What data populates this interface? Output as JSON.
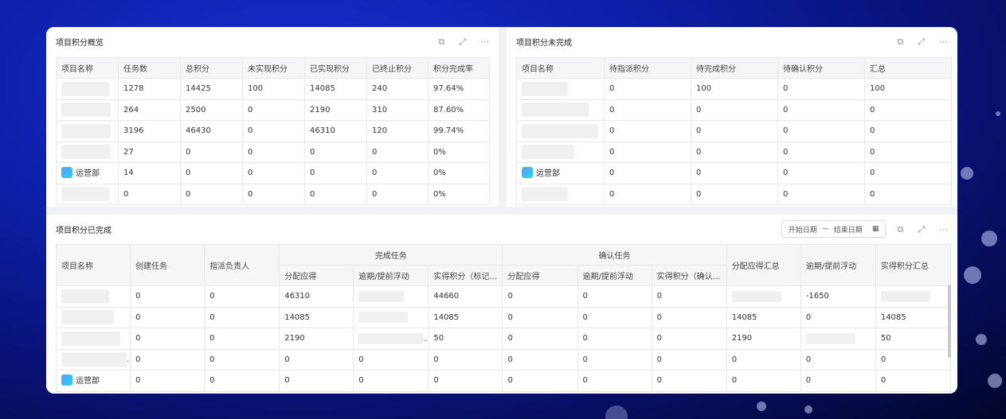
{
  "icons": {
    "export": "export-icon",
    "expand": "expand-icon",
    "more": "more-icon",
    "calendar": "calendar-icon",
    "dept": "dept-icon"
  },
  "overview": {
    "title": "项目积分概览",
    "headers": [
      "项目名称",
      "任务数",
      "总积分",
      "未实现积分",
      "已实现积分",
      "已终止积分",
      "积分完成率"
    ],
    "rows": [
      [
        "",
        "1278",
        "14425",
        "100",
        "14085",
        "240",
        "97.64%"
      ],
      [
        "",
        "264",
        "2500",
        "0",
        "2190",
        "310",
        "87.60%"
      ],
      [
        "",
        "3196",
        "46430",
        "0",
        "46310",
        "120",
        "99.74%"
      ],
      [
        "",
        "27",
        "0",
        "0",
        "0",
        "0",
        "0%"
      ],
      [
        "运营部",
        "14",
        "0",
        "0",
        "0",
        "0",
        "0%"
      ],
      [
        "",
        "0",
        "0",
        "0",
        "0",
        "0",
        "0%"
      ]
    ]
  },
  "incomplete": {
    "title": "项目积分未完成",
    "headers": [
      "项目名称",
      "待指派积分",
      "待完成积分",
      "待确认积分",
      "汇总"
    ],
    "rows": [
      [
        "",
        "0",
        "100",
        "0",
        "100"
      ],
      [
        "",
        "0",
        "0",
        "0",
        "0"
      ],
      [
        "",
        "0",
        "0",
        "0",
        "0"
      ],
      [
        "",
        "0",
        "0",
        "0",
        "0"
      ],
      [
        "运营部",
        "0",
        "0",
        "0",
        "0"
      ],
      [
        "",
        "0",
        "0",
        "0",
        "0"
      ]
    ]
  },
  "completed": {
    "title": "项目积分已完成",
    "date_start_placeholder": "开始日期",
    "date_separator": "—",
    "date_end_placeholder": "结束日期",
    "headers_top": [
      "项目名称",
      "创建任务",
      "指派负责人",
      "完成任务",
      "确认任务",
      "分配应得汇总",
      "逾期/提前浮动",
      "实得积分汇总"
    ],
    "headers_sub": [
      "分配应得",
      "逾期/提前浮动",
      "实得积分（标记...",
      "分配应得",
      "逾期/提前浮动",
      "实得积分（确认..."
    ],
    "rows": [
      [
        "",
        "0",
        "0",
        "46310",
        "",
        "44660",
        "0",
        "0",
        "0",
        "",
        "-1650",
        ""
      ],
      [
        "",
        "0",
        "0",
        "14085",
        "",
        "14085",
        "0",
        "0",
        "0",
        "14085",
        "0",
        "14085"
      ],
      [
        "",
        "0",
        "0",
        "2190",
        "",
        "50",
        "0",
        "0",
        "0",
        "2190",
        "",
        "50"
      ],
      [
        "",
        "0",
        "0",
        "0",
        "0",
        "0",
        "0",
        "0",
        "0",
        "0",
        "0",
        "0"
      ],
      [
        "运营部",
        "0",
        "0",
        "0",
        "0",
        "0",
        "0",
        "0",
        "0",
        "0",
        "0",
        "0"
      ]
    ]
  }
}
